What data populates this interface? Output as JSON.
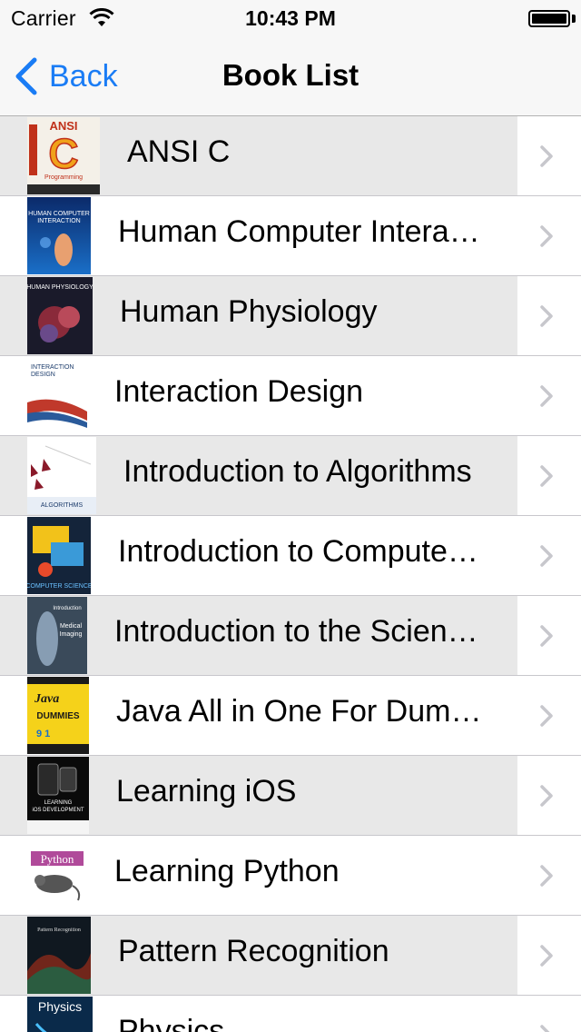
{
  "status_bar": {
    "carrier": "Carrier",
    "time": "10:43 PM"
  },
  "nav_bar": {
    "back_label": "Back",
    "title": "Book List",
    "accent_color": "#1a7cf5"
  },
  "books": [
    {
      "title": "ANSI C",
      "cover": "ansi-c-cover"
    },
    {
      "title": "Human Computer Intera…",
      "cover": "hci-cover"
    },
    {
      "title": "Human Physiology",
      "cover": "human-physiology-cover"
    },
    {
      "title": "Interaction Design",
      "cover": "interaction-design-cover"
    },
    {
      "title": "Introduction to Algorithms",
      "cover": "algorithms-cover"
    },
    {
      "title": "Introduction to Compute…",
      "cover": "computer-science-cover"
    },
    {
      "title": "Introduction to the Scien…",
      "cover": "medical-imaging-cover"
    },
    {
      "title": "Java All in One For Dum…",
      "cover": "java-dummies-cover"
    },
    {
      "title": "Learning iOS",
      "cover": "learning-ios-cover"
    },
    {
      "title": "Learning Python",
      "cover": "learning-python-cover"
    },
    {
      "title": "Pattern Recognition",
      "cover": "pattern-recognition-cover"
    },
    {
      "title": "Physics",
      "cover": "physics-cover"
    }
  ]
}
